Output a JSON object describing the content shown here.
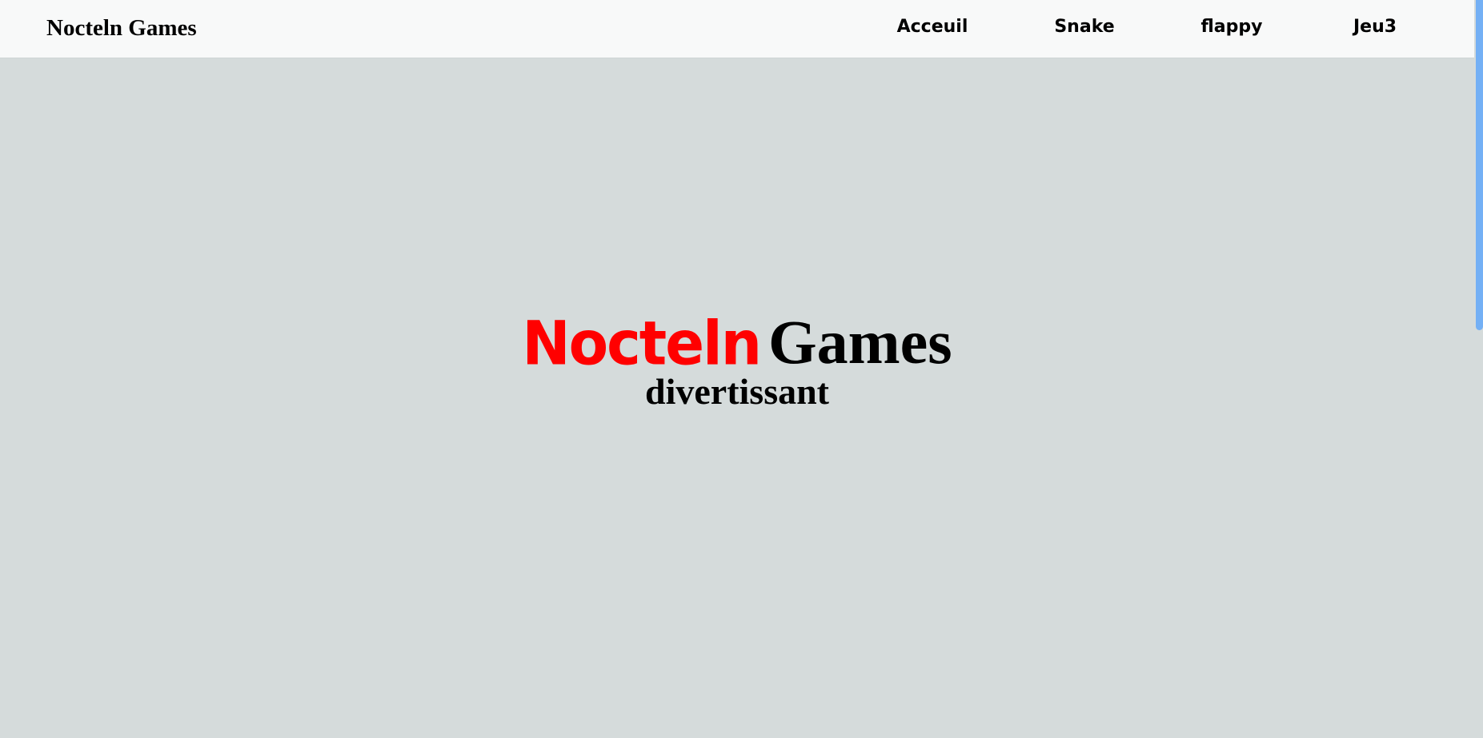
{
  "navbar": {
    "brand": "Nocteln Games",
    "links": [
      {
        "label": "Acceuil"
      },
      {
        "label": "Snake"
      },
      {
        "label": "flappy"
      },
      {
        "label": "Jeu3"
      }
    ]
  },
  "hero": {
    "title_highlight": "Nocteln",
    "title_rest": "Games",
    "subtitle": "divertissant"
  },
  "colors": {
    "background": "#d5dbdb",
    "navbar_background": "#f8f9f9",
    "highlight": "#ff0000",
    "scrollbar_thumb": "#74b0f5"
  }
}
